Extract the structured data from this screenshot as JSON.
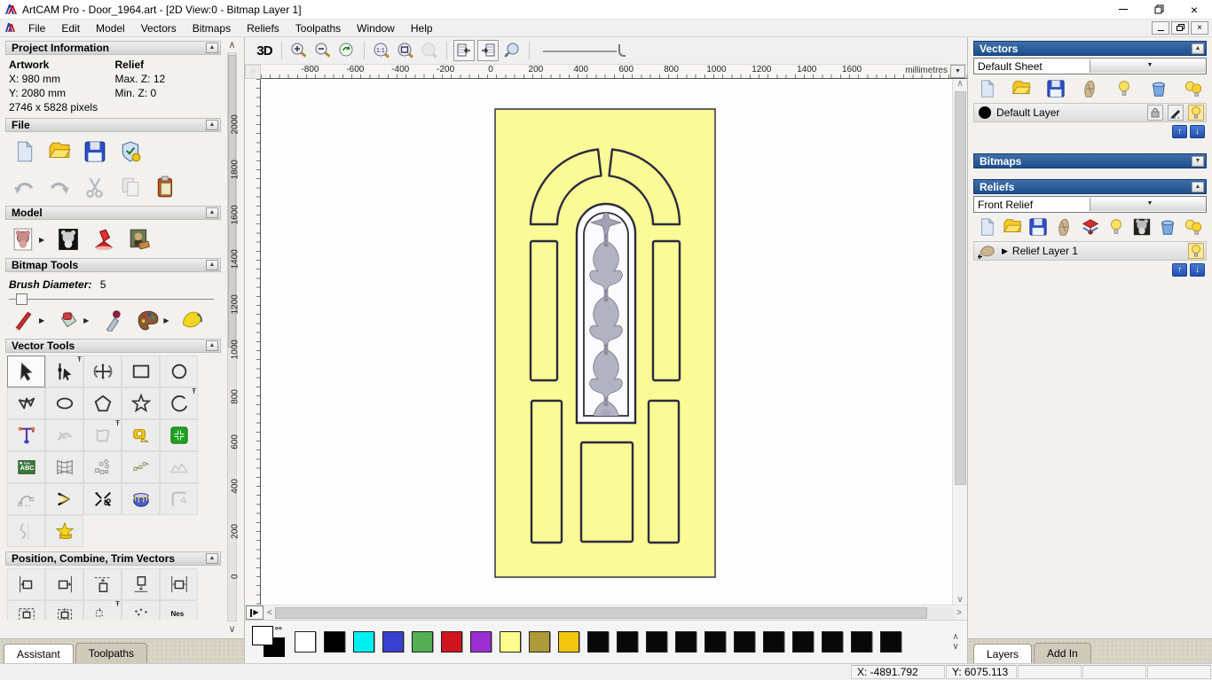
{
  "window": {
    "title": "ArtCAM Pro - Door_1964.art - [2D View:0 - Bitmap Layer 1]",
    "controls": [
      "minimize-icon",
      "restore-icon",
      "close-icon"
    ]
  },
  "menu": {
    "items": [
      "File",
      "Edit",
      "Model",
      "Vectors",
      "Bitmaps",
      "Reliefs",
      "Toolpaths",
      "Window",
      "Help"
    ],
    "mdi_controls": [
      "minimize-icon",
      "restore-icon",
      "close-icon"
    ]
  },
  "assistant": {
    "project_information": {
      "title": "Project Information",
      "artwork_label": "Artwork",
      "relief_label": "Relief",
      "artwork_x": "X: 980 mm",
      "artwork_y": "Y: 2080 mm",
      "relief_max_z": "Max. Z: 12",
      "relief_min_z": "Min. Z: 0",
      "pixels": "2746 x 5828 pixels"
    },
    "file_section": {
      "title": "File",
      "icons": [
        "new-model-icon",
        "open-file-icon",
        "save-file-icon",
        "license-icon",
        "undo-icon",
        "redo-icon",
        "cut-icon",
        "copy-icon",
        "paste-icon"
      ]
    },
    "model_section": {
      "title": "Model",
      "icons": [
        "adjust-model-icon",
        "invert-model-icon",
        "lighting-icon",
        "load-bitmap-icon"
      ]
    },
    "bitmap_tools": {
      "title": "Bitmap Tools",
      "brush_label": "Brush Diameter:",
      "brush_value": "5",
      "icons": [
        "paint-brush-icon",
        "paint-bucket-icon",
        "pick-colour-icon",
        "palette-icon",
        "flood-fill-icon"
      ]
    },
    "vector_tools": {
      "title": "Vector Tools",
      "icons": [
        "select-vectors-icon",
        "node-editing-icon",
        "transform-vectors-icon",
        "create-rectangle-icon",
        "create-circle-icon",
        "create-polyline-icon",
        "create-ellipse-icon",
        "create-polygon-icon",
        "create-star-icon",
        "create-arc-icon",
        "create-text-icon",
        "wrap-text-icon",
        "envelope-icon",
        "measure-icon",
        "add-vector-icon",
        "text-block-icon",
        "distort-grid-icon",
        "paste-along-curve-icon",
        "nesting-points-icon",
        "free-relief-icon",
        "fit-curve-icon",
        "join-vectors-icon",
        "trim-vectors-icon",
        "weave-vectors-icon",
        "fillet-icon",
        "offset-icon",
        "vector-doctor-icon"
      ]
    },
    "position_section": {
      "title": "Position, Combine, Trim Vectors",
      "icons": [
        "align-left-icon",
        "align-right-icon",
        "align-top-icon",
        "align-bottom-icon",
        "center-horizontal-icon",
        "center-in-page-icon",
        "align-centers-icon",
        "paste-array-icon",
        "block-copy-icon",
        "nesting-icon"
      ]
    },
    "tabs": {
      "assistant": "Assistant",
      "toolpaths": "Toolpaths"
    }
  },
  "view2d": {
    "toolbar": {
      "label_3d": "3D",
      "icons": [
        "zoom-in-icon",
        "zoom-out-icon",
        "zoom-previous-icon",
        "zoom-1to1-icon",
        "zoom-fit-icon",
        "zoom-object-icon",
        "toggle-bitmap-icon",
        "toggle-vector-icon",
        "preview-icon",
        "zoom-slider"
      ]
    },
    "ruler": {
      "unit": "millimetres",
      "top_labels": [
        "-800",
        "-600",
        "-400",
        "-200",
        "0",
        "200",
        "400",
        "600",
        "800",
        "1000",
        "1200",
        "1400",
        "1600"
      ],
      "left_labels": [
        "2000",
        "1800",
        "1600",
        "1400",
        "1200",
        "1000",
        "800",
        "600",
        "400",
        "200",
        "0"
      ]
    },
    "door": {
      "fill": "#fafa96",
      "line": "#2b2b40"
    }
  },
  "palette": {
    "swatches": [
      "#ffffff",
      "#000000",
      "#00f0f0",
      "#3a41d0",
      "#54ae54",
      "#d01420",
      "#9c2fd4",
      "#fdfd8d",
      "#ac9b38",
      "#f2c50f",
      "#080808",
      "#080808",
      "#080808",
      "#080808",
      "#080808",
      "#080808",
      "#080808",
      "#080808",
      "#080808",
      "#080808",
      "#080808"
    ],
    "foreground": "#ffffff",
    "background": "#000000"
  },
  "layers_panel": {
    "vectors": {
      "title": "Vectors",
      "sheet": "Default Sheet",
      "icons": [
        "new-layer-icon",
        "open-layer-icon",
        "save-layer-icon",
        "merge-layers-icon",
        "toggle-visibility-icon",
        "delete-layer-icon",
        "all-layers-visibility-icon"
      ],
      "layer": {
        "name": "Default Layer",
        "color": "#000000",
        "row_icons": [
          "lock-icon",
          "snap-pen-icon",
          "bulb-icon"
        ]
      }
    },
    "bitmaps": {
      "title": "Bitmaps"
    },
    "reliefs": {
      "title": "Reliefs",
      "relief": "Front Relief",
      "icons": [
        "new-layer-icon",
        "open-layer-icon",
        "save-layer-icon",
        "merge-layers-icon",
        "stack-icon",
        "toggle-visibility-icon",
        "greyscale-icon",
        "delete-layer-icon",
        "all-layers-visibility-icon"
      ],
      "layer": {
        "name": "Relief Layer 1",
        "row_icons": [
          "bulb-icon"
        ]
      }
    },
    "tabs": {
      "layers": "Layers",
      "addin": "Add In"
    }
  },
  "status_bar": {
    "x": "X: -4891.792",
    "y": "Y: 6075.113"
  }
}
